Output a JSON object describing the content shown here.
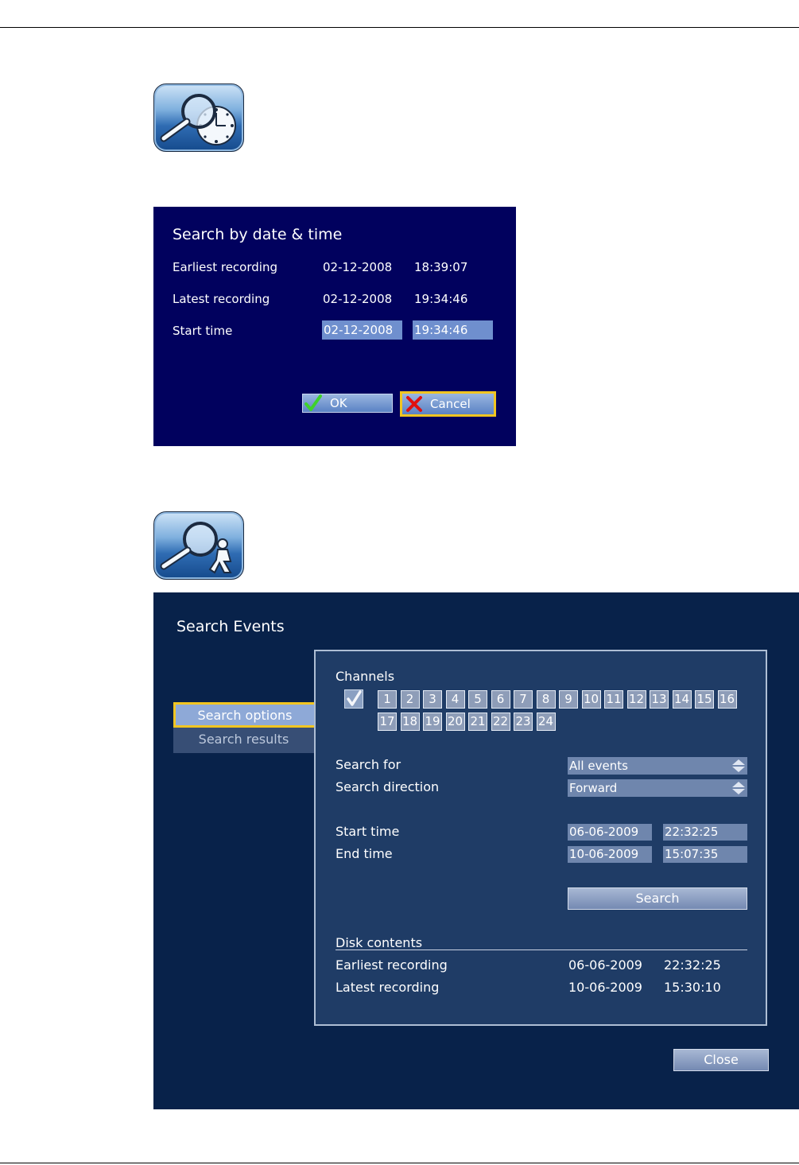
{
  "dialog_date_time": {
    "title": "Search by date & time",
    "earliest_label": "Earliest recording",
    "earliest_date": "02-12-2008",
    "earliest_time": "18:39:07",
    "latest_label": "Latest recording",
    "latest_date": "02-12-2008",
    "latest_time": "19:34:46",
    "start_label": "Start time",
    "start_date": "02-12-2008",
    "start_time": "19:34:46",
    "ok_label": "OK",
    "cancel_label": "Cancel"
  },
  "dialog_events": {
    "title": "Search Events",
    "tabs": {
      "options": "Search options",
      "results": "Search results"
    },
    "channels_label": "Channels",
    "channels": [
      "1",
      "2",
      "3",
      "4",
      "5",
      "6",
      "7",
      "8",
      "9",
      "10",
      "11",
      "12",
      "13",
      "14",
      "15",
      "16",
      "17",
      "18",
      "19",
      "20",
      "21",
      "22",
      "23",
      "24"
    ],
    "search_for_label": "Search for",
    "search_for_value": "All events",
    "direction_label": "Search direction",
    "direction_value": "Forward",
    "start_label": "Start time",
    "start_date": "06-06-2009",
    "start_time": "22:32:25",
    "end_label": "End time",
    "end_date": "10-06-2009",
    "end_time": "15:07:35",
    "search_button": "Search",
    "disk_contents_label": "Disk contents",
    "earliest_label": "Earliest recording",
    "earliest_date": "06-06-2009",
    "earliest_time": "22:32:25",
    "latest_label": "Latest recording",
    "latest_date": "10-06-2009",
    "latest_time": "15:30:10",
    "close_button": "Close"
  },
  "icons": [
    "search-time-icon",
    "search-event-icon",
    "check-icon",
    "cross-icon",
    "updown-arrows-icon"
  ],
  "colors": {
    "dialog1_bg": "#01015e",
    "dialog2_bg": "#08224a",
    "focus": "#f1c521",
    "field": "#6f8fce"
  }
}
